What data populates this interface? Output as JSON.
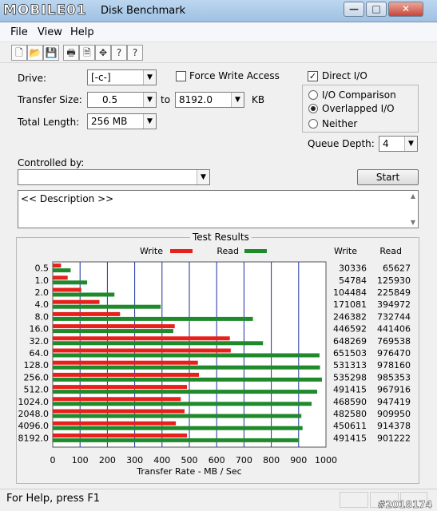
{
  "window": {
    "watermark_logo": "MOBILE01",
    "title": "Disk Benchmark",
    "minimize_label": "—",
    "maximize_label": "□",
    "close_label": "✕"
  },
  "menu": [
    "File",
    "View",
    "Help"
  ],
  "toolbar_icons": [
    "new-icon",
    "open-icon",
    "save-icon",
    "print-icon",
    "print-preview-icon",
    "move-icon",
    "help-icon",
    "context-help-icon"
  ],
  "toolbar_glyphs": [
    "🗋",
    "📂",
    "💾",
    "🖶",
    "🗎",
    "✥",
    "?",
    "?"
  ],
  "form": {
    "drive_label": "Drive:",
    "drive_value": "[-c-]",
    "force_write_label": "Force Write Access",
    "force_write_checked": false,
    "direct_io_label": "Direct I/O",
    "direct_io_checked": true,
    "transfer_size_label": "Transfer Size:",
    "transfer_from": "0.5",
    "to_label": "to",
    "transfer_to": "8192.0",
    "kb_label": "KB",
    "total_length_label": "Total Length:",
    "total_length_value": "256 MB",
    "io_comparison_label": "I/O Comparison",
    "overlapped_io_label": "Overlapped I/O",
    "neither_label": "Neither",
    "selected_mode": "Overlapped I/O",
    "queue_depth_label": "Queue Depth:",
    "queue_depth_value": "4",
    "controlled_by_label": "Controlled by:",
    "controlled_by_value": "",
    "start_label": "Start",
    "description_text": "<< Description >>"
  },
  "results_title": "Test Results",
  "chart_data": {
    "type": "bar",
    "orientation": "horizontal",
    "categories": [
      "0.5",
      "1.0",
      "2.0",
      "4.0",
      "8.0",
      "16.0",
      "32.0",
      "64.0",
      "128.0",
      "256.0",
      "512.0",
      "1024.0",
      "2048.0",
      "4096.0",
      "8192.0"
    ],
    "series": [
      {
        "name": "Write",
        "color": "#e8201c",
        "values": [
          30336,
          54784,
          104484,
          171081,
          246382,
          446592,
          648269,
          651503,
          531313,
          535298,
          491415,
          468590,
          482580,
          450611,
          491415
        ]
      },
      {
        "name": "Read",
        "color": "#1f8a2b",
        "values": [
          65627,
          125930,
          225849,
          394972,
          732744,
          441406,
          769538,
          976470,
          978160,
          985353,
          967916,
          947419,
          909950,
          914378,
          901222
        ]
      }
    ],
    "column_headers": [
      "Write",
      "Read"
    ],
    "xticks": [
      "0",
      "100",
      "200",
      "300",
      "400",
      "500",
      "600",
      "700",
      "800",
      "900",
      "1000"
    ],
    "xlim": [
      0,
      1000
    ],
    "xlabel": "Transfer Rate - MB / Sec",
    "legend": "top-center",
    "grid": true
  },
  "status": {
    "text": "For Help, press F1",
    "watermark": "#2018174"
  }
}
